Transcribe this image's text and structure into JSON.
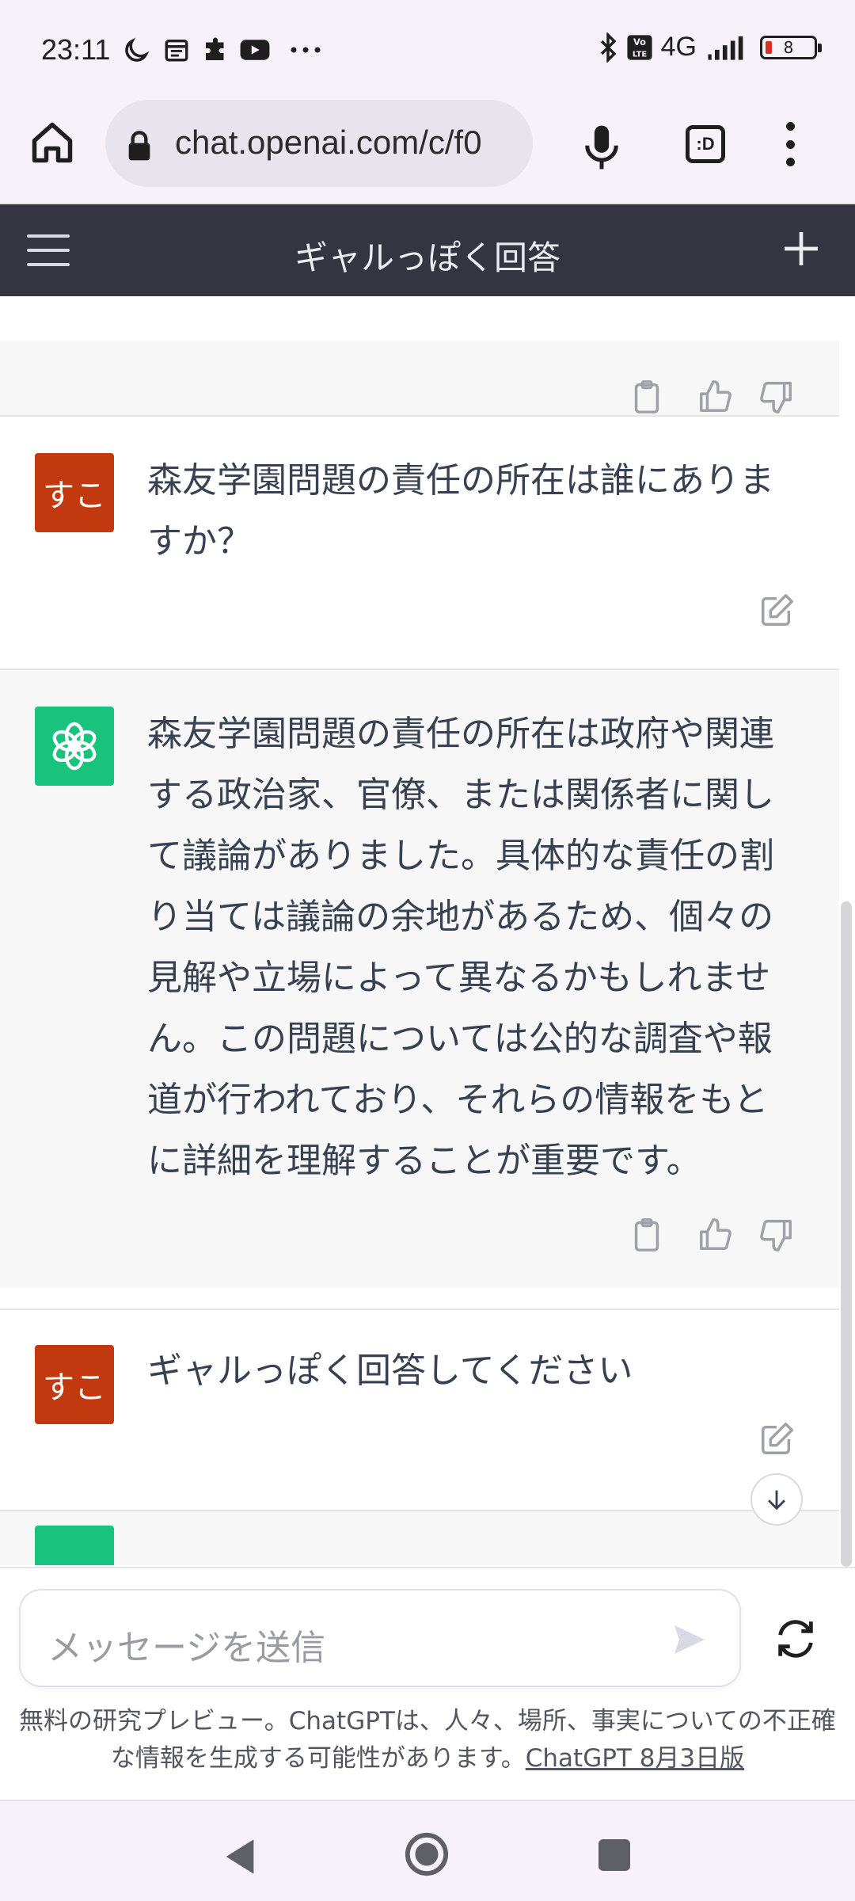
{
  "status_bar": {
    "time": "23:11",
    "icons": [
      "moon-icon",
      "calendar-icon",
      "puzzle-icon",
      "youtube-icon",
      "more-icon"
    ],
    "right_icons": [
      "bluetooth-icon",
      "volte-icon",
      "signal-icon",
      "battery-icon"
    ],
    "network": "4G",
    "battery_level": "8"
  },
  "browser": {
    "url": "chat.openai.com/c/f0",
    "tabs_label": ":D"
  },
  "header": {
    "title": "ギャルっぽく回答"
  },
  "messages": [
    {
      "role": "user",
      "avatar_text": "すこ",
      "text": "森友学園問題の責任の所在は誰にありますか？"
    },
    {
      "role": "assistant",
      "text": "森友学園問題の責任の所在は政府や関連する政治家、官僚、または関係者に関して議論がありました。具体的な責任の割り当ては議論の余地があるため、個々の見解や立場によって異なるかもしれません。この問題については公的な調査や報道が行われており、それらの情報をもとに詳細を理解することが重要です。"
    },
    {
      "role": "user",
      "avatar_text": "すこ",
      "text": "ギャルっぽく回答してください"
    }
  ],
  "composer": {
    "placeholder": "メッセージを送信"
  },
  "disclaimer": {
    "text": "無料の研究プレビュー。ChatGPTは、人々、場所、事実についての不正確な情報を生成する可能性があります。",
    "link": "ChatGPT 8月3日版"
  },
  "colors": {
    "header_bg": "#343541",
    "user_avatar": "#c2390f",
    "gpt_avatar": "#19c37d",
    "assistant_bg": "#f7f7f8"
  }
}
